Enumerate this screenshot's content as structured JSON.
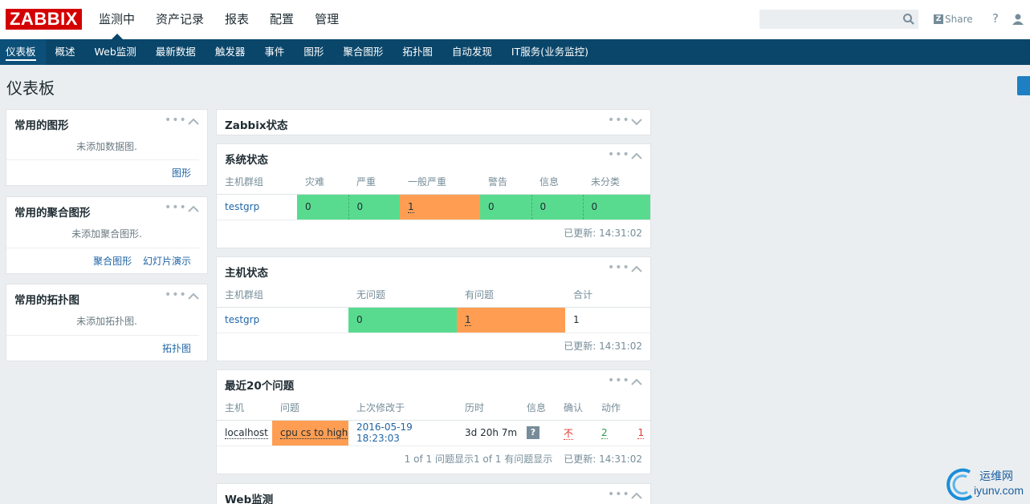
{
  "topbar": {
    "logo": "ZABBIX",
    "nav": [
      "监测中",
      "资产记录",
      "报表",
      "配置",
      "管理"
    ],
    "active_nav": 0,
    "search_placeholder": "",
    "share": "Share",
    "help": "?"
  },
  "subnav": {
    "items": [
      "仪表板",
      "概述",
      "Web监测",
      "最新数据",
      "触发器",
      "事件",
      "图形",
      "聚合图形",
      "拓扑图",
      "自动发现",
      "IT服务(业务监控)"
    ],
    "active": 0
  },
  "page": {
    "title": "仪表板"
  },
  "left": {
    "graphs": {
      "title": "常用的图形",
      "empty": "未添加数据图.",
      "links": [
        "图形"
      ]
    },
    "screens": {
      "title": "常用的聚合图形",
      "empty": "未添加聚合图形.",
      "links": [
        "聚合图形",
        "幻灯片演示"
      ]
    },
    "maps": {
      "title": "常用的拓扑图",
      "empty": "未添加拓扑图.",
      "links": [
        "拓扑图"
      ]
    }
  },
  "zabbix_status": {
    "title": "Zabbix状态"
  },
  "system_status": {
    "title": "系统状态",
    "headers": [
      "主机群组",
      "灾难",
      "严重",
      "一般严重",
      "警告",
      "信息",
      "未分类"
    ],
    "row": {
      "group": "testgrp",
      "values": [
        "0",
        "0",
        "1",
        "0",
        "0",
        "0"
      ]
    },
    "updated": "已更新: 14:31:02"
  },
  "host_status": {
    "title": "主机状态",
    "headers": [
      "主机群组",
      "无问题",
      "有问题",
      "合计"
    ],
    "row": {
      "group": "testgrp",
      "ok": "0",
      "problem": "1",
      "total": "1"
    },
    "updated": "已更新: 14:31:02"
  },
  "last_issues": {
    "title": "最近20个问题",
    "headers": [
      "主机",
      "问题",
      "上次修改于",
      "历时",
      "信息",
      "确认",
      "动作"
    ],
    "row": {
      "host": "localhost",
      "issue": "cpu cs to high",
      "last_change": "2016-05-19 18:23:03",
      "age": "3d 20h 7m",
      "info": "?",
      "ack": "不",
      "actions_ok": "2",
      "actions_fail": "1"
    },
    "summary": "1 of 1 问题显示1 of 1 有问题显示",
    "updated": "已更新: 14:31:02"
  },
  "web_monitoring": {
    "title": "Web监测"
  },
  "watermark": {
    "line1": "运维网",
    "line2": "iyunv.com"
  },
  "colors": {
    "navbar": "#0a466a",
    "ok": "#59db8f",
    "problem": "#ff9e53",
    "logo": "#d40000"
  }
}
